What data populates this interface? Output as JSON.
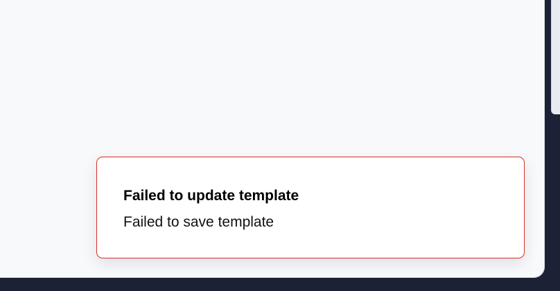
{
  "toast": {
    "title": "Failed to update template",
    "message": "Failed to save template",
    "border_color": "#d93025"
  },
  "colors": {
    "page_background": "#f8f9fb",
    "frame_background": "#1b2235",
    "text": "#000000"
  }
}
